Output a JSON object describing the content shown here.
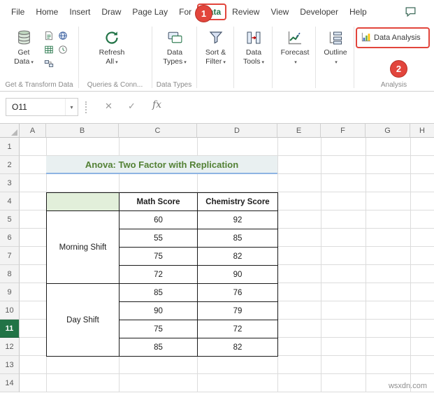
{
  "annotations": {
    "step1": "1",
    "step2": "2"
  },
  "icons": {
    "dropdown_caret": "▾",
    "namebox_caret": "▾"
  },
  "ribbon": {
    "tabs": [
      "File",
      "Home",
      "Insert",
      "Draw",
      "Page Lay",
      "For",
      "Data",
      "Review",
      "View",
      "Developer",
      "Help"
    ],
    "buttons": {
      "get_data": {
        "line1": "Get",
        "line2": "Data"
      },
      "refresh_all": {
        "line1": "Refresh",
        "line2": "All"
      },
      "data_types": {
        "line1": "Data",
        "line2": "Types"
      },
      "sort_filter": {
        "line1": "Sort &",
        "line2": "Filter"
      },
      "data_tools": {
        "line1": "Data",
        "line2": "Tools"
      },
      "forecast": {
        "line1": "Forecast",
        "line2": ""
      },
      "outline": {
        "line1": "Outline",
        "line2": ""
      },
      "data_analysis": "Data Analysis"
    },
    "group_labels": {
      "get_transform": "Get & Transform Data",
      "queries": "Queries & Conn...",
      "data_types": "Data Types",
      "analysis": "Analysis"
    }
  },
  "formula_bar": {
    "name_box": "O11",
    "cancel": "✕",
    "enter": "✓",
    "fx": "fx",
    "value": ""
  },
  "sheet": {
    "columns": [
      "A",
      "B",
      "C",
      "D",
      "E",
      "F",
      "G",
      "H"
    ],
    "rows": [
      "1",
      "2",
      "3",
      "4",
      "5",
      "6",
      "7",
      "8",
      "9",
      "10",
      "11",
      "12",
      "13",
      "14"
    ],
    "selected_row": "11",
    "title": "Anova: Two Factor with Replication",
    "table": {
      "headers": [
        "Math Score",
        "Chemistry Score"
      ],
      "groups": [
        "Morning Shift",
        "Day Shift"
      ],
      "math": [
        "60",
        "55",
        "75",
        "72",
        "85",
        "90",
        "75",
        "85"
      ],
      "chemistry": [
        "92",
        "85",
        "82",
        "90",
        "76",
        "79",
        "72",
        "82"
      ]
    }
  },
  "watermark": "wsxdn.com"
}
